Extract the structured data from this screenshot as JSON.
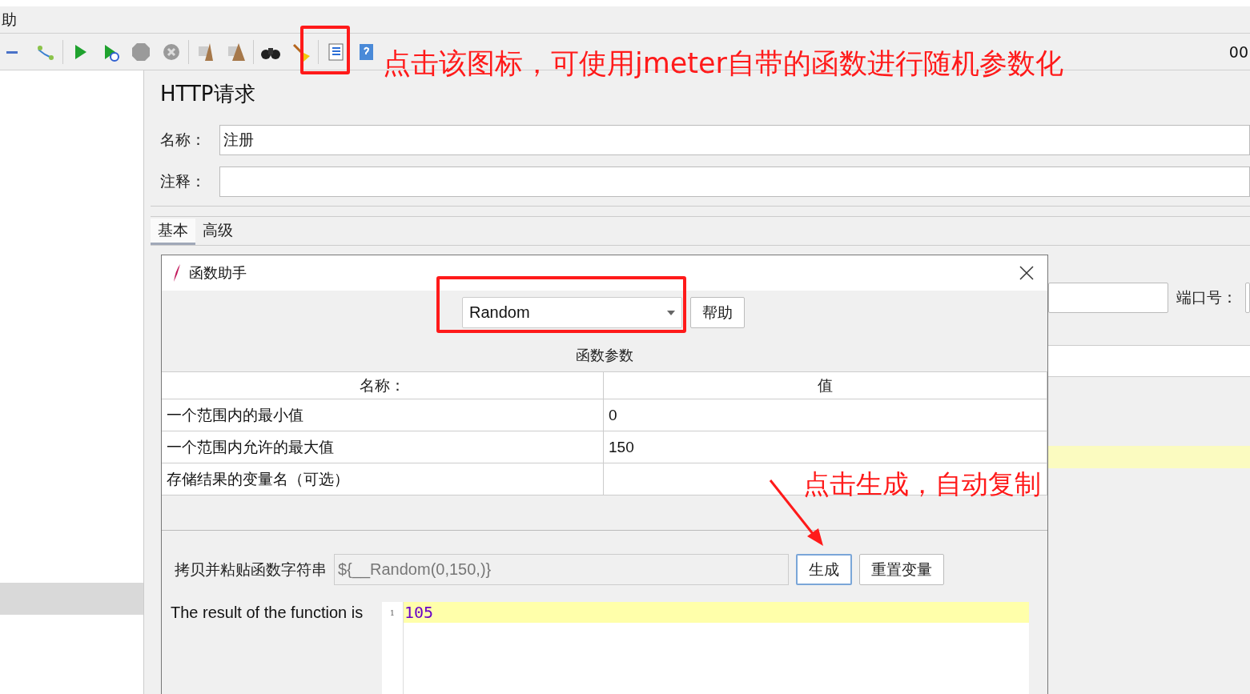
{
  "menu": {
    "items": [
      "助"
    ]
  },
  "toolbar": {
    "clock": "00"
  },
  "panel": {
    "title": "HTTP请求",
    "fields": [
      {
        "label": "名称：",
        "value": "注册"
      },
      {
        "label": "注释："
      }
    ]
  },
  "tabs": [
    {
      "label": "基本",
      "selected": true
    },
    {
      "label": "高级",
      "selected": false
    }
  ],
  "server": {
    "port_label": "端口号："
  },
  "dialog": {
    "title": "函数助手",
    "function": "Random",
    "help_button": "帮助",
    "params_title": "函数参数",
    "columns": [
      "名称：",
      "值"
    ],
    "rows": [
      {
        "name": "一个范围内的最小值",
        "value": "0"
      },
      {
        "name": "一个范围内允许的最大值",
        "value": "150"
      },
      {
        "name": "存储结果的变量名（可选）"
      }
    ],
    "copy_label": "拷贝并粘贴函数字符串",
    "copy_value": "${__Random(0,150,)}",
    "buttons": [
      {
        "label": "生成",
        "focused": true
      },
      {
        "label": "重置变量",
        "focused": false
      }
    ],
    "result_label": "The result of the function is",
    "result_lines": [
      {
        "number": "1",
        "text": "105"
      }
    ]
  },
  "annotations": [
    {
      "kind": "text",
      "text": "点击该图标，可使用jmeter自带的函数进行随机参数化"
    },
    {
      "kind": "text",
      "text": "点击生成，自动复制"
    }
  ]
}
